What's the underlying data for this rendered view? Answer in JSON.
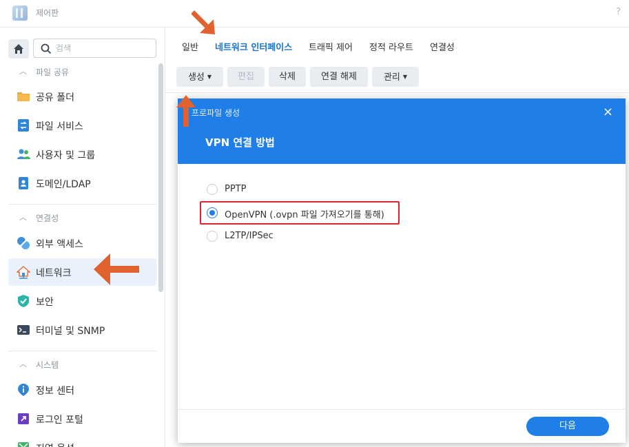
{
  "window": {
    "title": "제어판",
    "help": "?"
  },
  "sidebar": {
    "search_placeholder": "검색",
    "groups": [
      {
        "label": "파일 공유",
        "items": [
          {
            "label": "공유 폴더",
            "icon": "folder-icon"
          },
          {
            "label": "파일 서비스",
            "icon": "file-services-icon"
          },
          {
            "label": "사용자 및 그룹",
            "icon": "users-icon"
          },
          {
            "label": "도메인/LDAP",
            "icon": "domain-icon"
          }
        ]
      },
      {
        "label": "연결성",
        "items": [
          {
            "label": "외부 액세스",
            "icon": "external-access-icon"
          },
          {
            "label": "네트워크",
            "icon": "network-house-icon",
            "active": true
          },
          {
            "label": "보안",
            "icon": "shield-icon"
          },
          {
            "label": "터미널 및 SNMP",
            "icon": "terminal-icon"
          }
        ]
      },
      {
        "label": "시스템",
        "items": [
          {
            "label": "정보 센터",
            "icon": "info-icon"
          },
          {
            "label": "로그인 포털",
            "icon": "login-portal-icon"
          },
          {
            "label": "지역 옵션",
            "icon": "regional-options-icon"
          }
        ]
      }
    ]
  },
  "tabs": [
    {
      "label": "일반"
    },
    {
      "label": "네트워크 인터페이스",
      "active": true
    },
    {
      "label": "트래픽 제어"
    },
    {
      "label": "정적 라우트"
    },
    {
      "label": "연결성"
    }
  ],
  "toolbar": {
    "create": "생성",
    "edit": "편집",
    "delete": "삭제",
    "disconnect": "연결 해제",
    "manage": "관리"
  },
  "modal": {
    "header_small": "프로파일 생성",
    "title": "VPN 연결 방법",
    "close": "×",
    "options": [
      {
        "label": "PPTP",
        "selected": false
      },
      {
        "label": "OpenVPN (.ovpn 파일 가져오기를 통해)",
        "selected": true
      },
      {
        "label": "L2TP/IPSec",
        "selected": false
      }
    ],
    "next_button": "다음"
  },
  "colors": {
    "accent": "#1f7ee8",
    "annotation": "#e0632f",
    "highlight": "#d9252c"
  }
}
